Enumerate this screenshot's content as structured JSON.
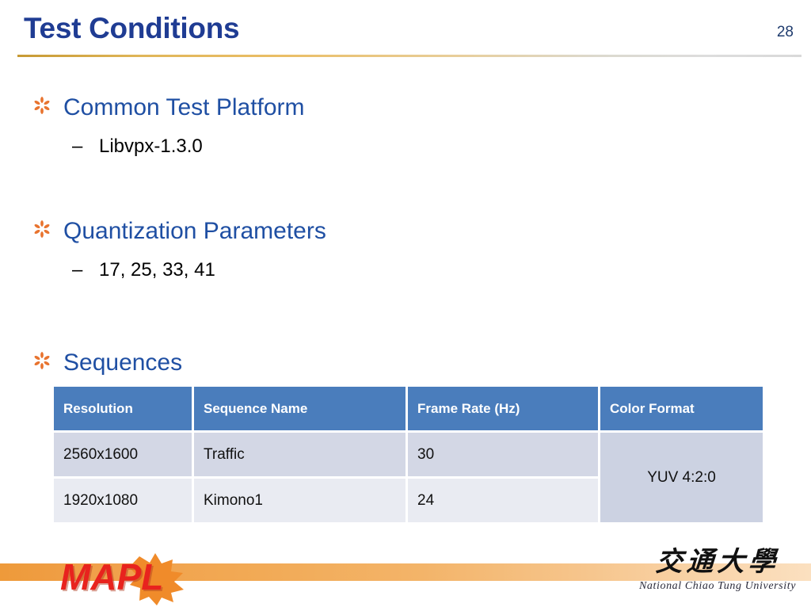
{
  "slide": {
    "title": "Test Conditions",
    "page_number": "28",
    "accent_blue": "#1F3C93",
    "bullet_blue": "#1F4FA3",
    "bullet_orange": "#E8732E",
    "rule_gold": "#E0B659"
  },
  "bullets": [
    {
      "marker": "asterisk-bullet",
      "heading": "Common Test Platform",
      "sub_marker": "–",
      "sub": "Libvpx-1.3.0"
    },
    {
      "marker": "asterisk-bullet",
      "heading": "Quantization Parameters",
      "sub_marker": "–",
      "sub": "17, 25, 33, 41"
    },
    {
      "marker": "asterisk-bullet",
      "heading": "Sequences"
    }
  ],
  "table": {
    "headers": [
      "Resolution",
      "Sequence Name",
      "Frame Rate (Hz)",
      "Color Format"
    ],
    "rows": [
      {
        "resolution": "2560x1600",
        "sequence_name": "Traffic",
        "frame_rate": "30"
      },
      {
        "resolution": "1920x1080",
        "sequence_name": "Kimono1",
        "frame_rate": "24"
      }
    ],
    "color_format": "YUV 4:2:0",
    "header_bg": "#4A7DBC",
    "row1_bg": "#D3D7E5",
    "row2_bg": "#E9EBF2",
    "span_bg": "#CCD2E2"
  },
  "footer": {
    "band_color": "#F0A04A",
    "left_logo": {
      "name": "MAPL",
      "text": "MAPL",
      "text_color": "#E8231E",
      "splash_color": "#F08B2A"
    },
    "right_logo": {
      "chinese": "交通大學",
      "english": "National Chiao Tung University"
    }
  }
}
